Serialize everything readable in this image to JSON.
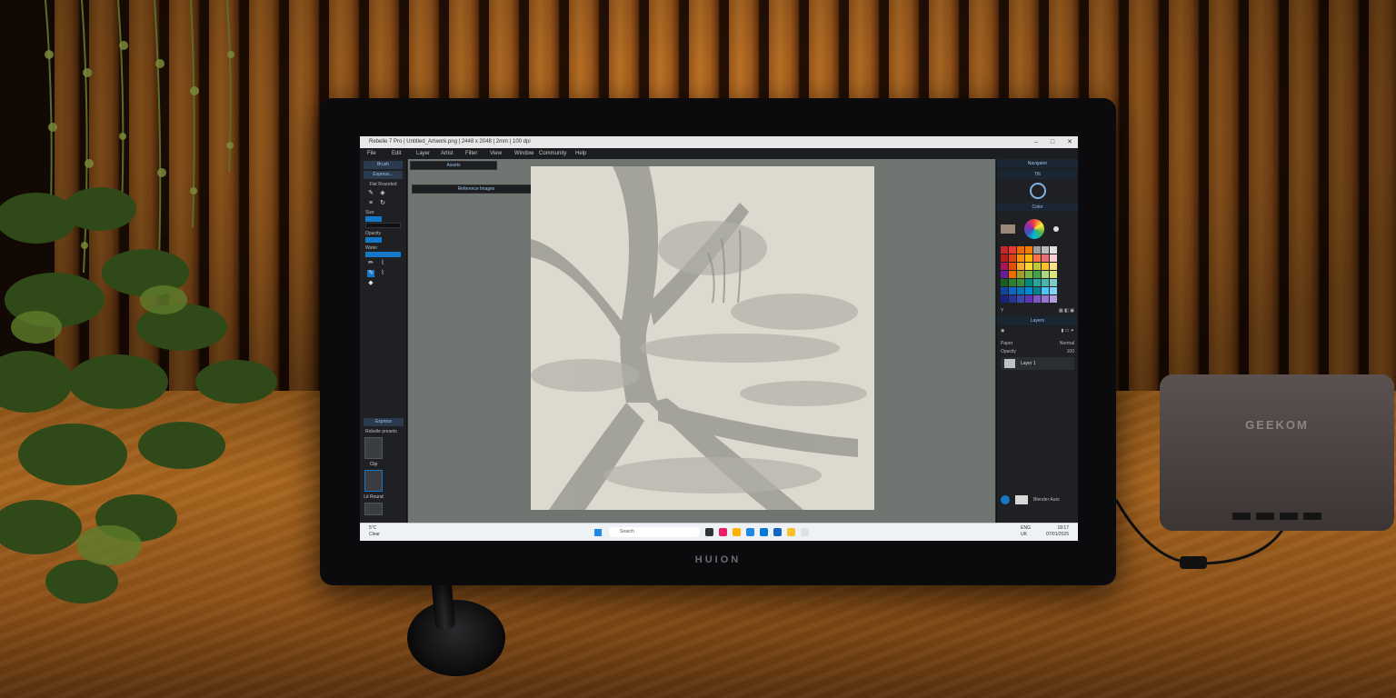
{
  "app": {
    "title": "Rebelle 7 Pro | Untitled_Artwork.png | 2448 x 2048 | 2mm | 100 dpi",
    "window_controls": [
      "–",
      "□",
      "✕"
    ]
  },
  "menu": [
    "File",
    "Edit",
    "Layer",
    "Artist",
    "Filter",
    "View",
    "Window",
    "Community",
    "Help"
  ],
  "left_panel": {
    "tab_brush": "Brush",
    "tab_express": "Express...",
    "brush_name": "Flat Rounded",
    "size_label": "Size",
    "opacity_label": "Opacity",
    "water_label": "Water",
    "presets_tab": "Express",
    "presets_filter": "Rebelle presets",
    "preset_1": "Clip",
    "preset_2": "Lit Round"
  },
  "canvas": {
    "assets_panel": "Assets",
    "reference_panel": "Reference Images"
  },
  "right_panel": {
    "navigator": "Navigator",
    "tilt": "Tilt",
    "color": "Color",
    "layers": "Layers",
    "blend_label": "Opacity",
    "blend_value": "100",
    "normal_label": "Normal",
    "layer_1": "Layer 1",
    "bottom_label": "Blender Auto"
  },
  "swatch_colors": [
    "#c62828",
    "#e53935",
    "#ef6c00",
    "#f57c00",
    "#9e9e9e",
    "#bdbdbd",
    "#e0e0e0",
    "#b71c1c",
    "#d84315",
    "#ff8f00",
    "#ffb300",
    "#ff7043",
    "#e57373",
    "#ffcdd2",
    "#ad1457",
    "#e65100",
    "#f9a825",
    "#fdd835",
    "#c0ca33",
    "#fbc02d",
    "#ffe082",
    "#6a1b9a",
    "#ef6c00",
    "#9e9d24",
    "#7cb342",
    "#43a047",
    "#aed581",
    "#dce775",
    "#1b5e20",
    "#2e7d32",
    "#388e3c",
    "#00897b",
    "#26a69a",
    "#4db6ac",
    "#80cbc4",
    "#0d47a1",
    "#1565c0",
    "#0277bd",
    "#0288d1",
    "#00838f",
    "#4fc3f7",
    "#81d4fa",
    "#1a237e",
    "#283593",
    "#3949ab",
    "#5e35b1",
    "#7e57c2",
    "#9575cd",
    "#b39ddb"
  ],
  "taskbar": {
    "weather_temp": "5°C",
    "weather_desc": "Clear",
    "search": "Search",
    "lang_1": "ENG",
    "lang_2": "UK",
    "time": "18:17",
    "date": "07/01/2025"
  },
  "hardware": {
    "monitor_brand": "HUION",
    "minipc_brand": "GEEKOM"
  }
}
